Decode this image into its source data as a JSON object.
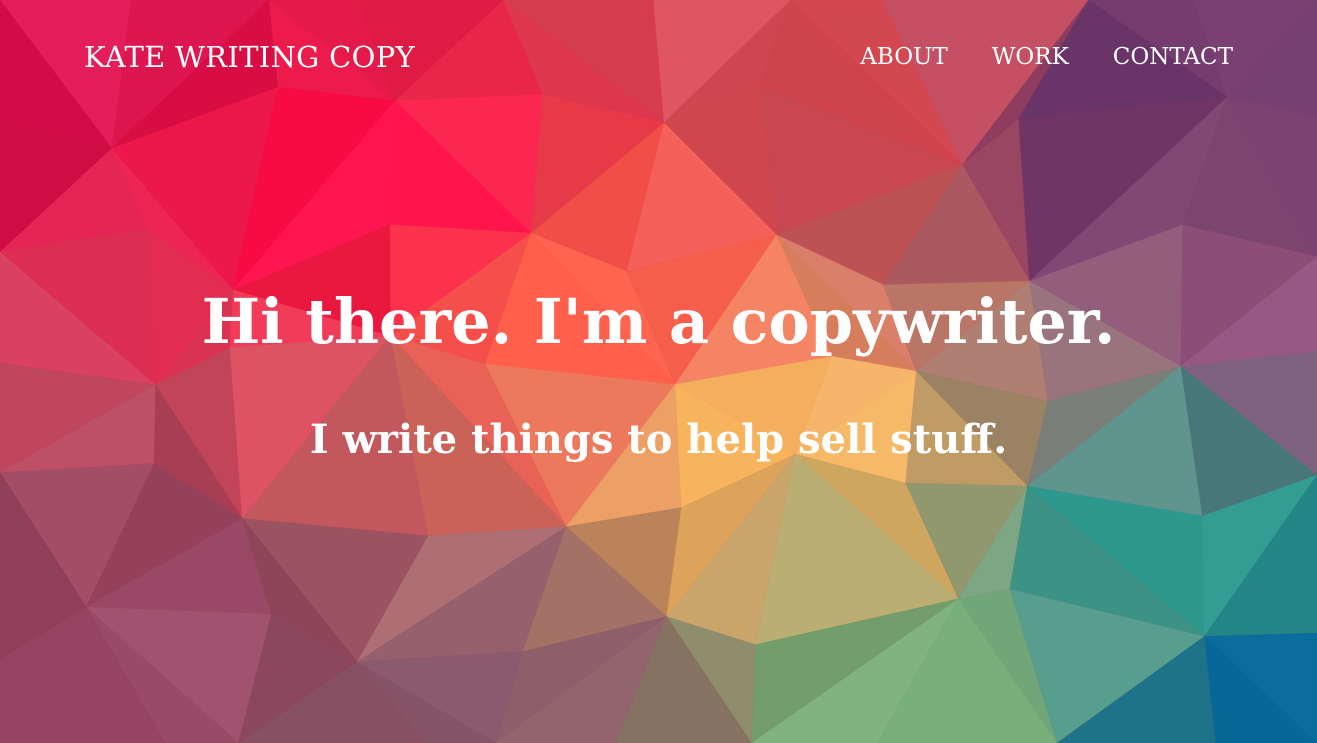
{
  "site": {
    "brand": "KATE WRITING COPY"
  },
  "nav": {
    "items": [
      {
        "label": "ABOUT"
      },
      {
        "label": "WORK"
      },
      {
        "label": "CONTACT"
      }
    ]
  },
  "hero": {
    "headline": "Hi there. I'm a copywriter.",
    "subheadline": "I write things to help sell stuff."
  },
  "theme": {
    "text_color": "#ffffff",
    "background_style": "low-poly gradient",
    "palette": [
      "#ff0a45",
      "#ff5a4a",
      "#ffbe5e",
      "#b8c07a",
      "#2a9d8a",
      "#0a76a0",
      "#6b3c74",
      "#8a4a7a"
    ]
  }
}
